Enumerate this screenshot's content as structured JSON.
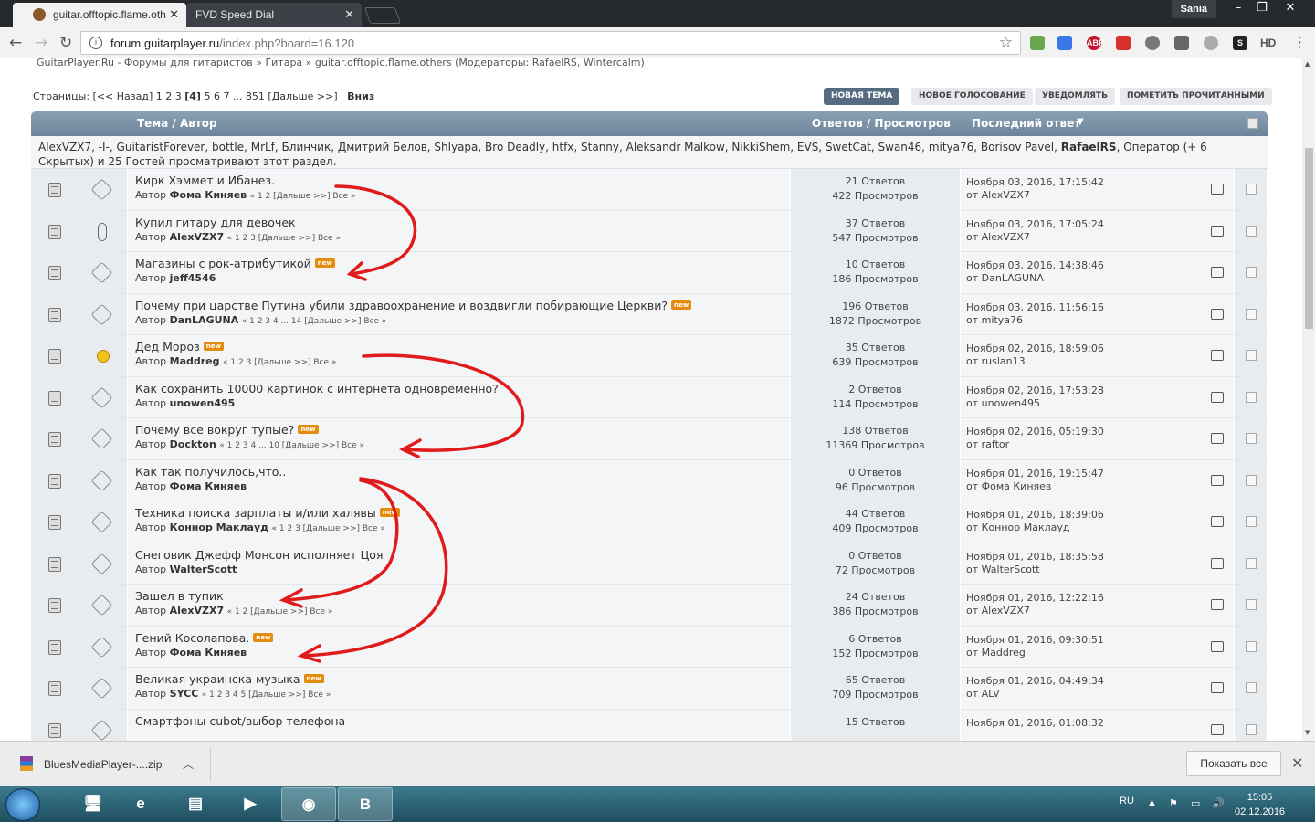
{
  "browser": {
    "tabs": [
      {
        "label": "guitar.offtopic.flame.oth"
      },
      {
        "label": "FVD Speed Dial"
      }
    ],
    "user": "Sania",
    "url_host": "forum.guitarplayer.ru",
    "url_path": "/index.php?board=16.120",
    "extensions": [
      "ABP",
      "S",
      "HD"
    ]
  },
  "forum": {
    "breadcrumb": "GuitarPlayer.Ru - Форумы для гитаристов » Гитара » guitar.offtopic.flame.others (Модераторы: RafaelRS, Wintercalm)",
    "pages_prefix": "Страницы: [<< Назад] 1 2 3",
    "pages_current": "[4]",
    "pages_suffix": "5 6 7 ... 851 [Дальше >>]",
    "pages_down": "Вниз",
    "buttons": {
      "new_topic": "НОВАЯ ТЕМА",
      "new_poll": "НОВОЕ ГОЛОСОВАНИЕ",
      "notify": "УВЕДОМЛЯТЬ",
      "mark_read": "ПОМЕТИТЬ ПРОЧИТАННЫМИ"
    },
    "header": {
      "topic": "Тема / Автор",
      "replies": "Ответов / Просмотров",
      "last": "Последний ответ"
    },
    "viewers_main": "AlexVZX7, -I-, GuitaristForever, bottle, MrLf, Блинчик, Дмитрий Белов, Shlyapa, Bro Deadly, htfx, Stanny, Aleksandr Malkow, NikkiShem, EVS, SwetCat, Swan46, mitya76, Borisov Pavel,",
    "viewers_bold": "RafaelRS",
    "viewers_tail": ", Оператор (+ 6 Скрытых) и 25 Гостей просматривают этот раздел.",
    "new_label": "new",
    "topics": [
      {
        "subject": "Кирк Хэммет и Ибанез.",
        "author_prefix": "Автор",
        "author": "Фома Киняев",
        "pages": "« 1 2 [Дальше >>]  Все »",
        "replies": "21 Ответов",
        "views": "422 Просмотров",
        "last_date": "Ноября 03, 2016, 17:15:42",
        "last_by": "от AlexVZX7",
        "is_new": false,
        "icon": "diamond"
      },
      {
        "subject": "Купил гитару для девочек",
        "author_prefix": "Автор",
        "author": "AlexVZX7",
        "pages": "« 1 2 3 [Дальше >>]  Все »",
        "replies": "37 Ответов",
        "views": "547 Просмотров",
        "last_date": "Ноября 03, 2016, 17:05:24",
        "last_by": "от AlexVZX7",
        "is_new": false,
        "icon": "clip"
      },
      {
        "subject": "Магазины с рок-атрибутикой",
        "author_prefix": "Автор",
        "author": "jeff4546",
        "pages": "",
        "replies": "10 Ответов",
        "views": "186 Просмотров",
        "last_date": "Ноября 03, 2016, 14:38:46",
        "last_by": "от DanLAGUNA",
        "is_new": true,
        "icon": "diamond"
      },
      {
        "subject": "Почему при царстве Путина убили здравоохранение и воздвигли побирающие Церкви?",
        "author_prefix": "Автор",
        "author": "DanLAGUNA",
        "pages": "« 1 2 3 4 ... 14 [Дальше >>]  Все »",
        "replies": "196 Ответов",
        "views": "1872 Просмотров",
        "last_date": "Ноября 03, 2016, 11:56:16",
        "last_by": "от mitya76",
        "is_new": true,
        "icon": "diamond"
      },
      {
        "subject": "Дед Мороз",
        "author_prefix": "Автор",
        "author": "Maddreg",
        "pages": "« 1 2 3 [Дальше >>]  Все »",
        "replies": "35 Ответов",
        "views": "639 Просмотров",
        "last_date": "Ноября 02, 2016, 18:59:06",
        "last_by": "от ruslan13",
        "is_new": true,
        "icon": "smile"
      },
      {
        "subject": "Как сохранить 10000 картинок с интернета одновременно?",
        "author_prefix": "Автор",
        "author": "unowen495",
        "pages": "",
        "replies": "2 Ответов",
        "views": "114 Просмотров",
        "last_date": "Ноября 02, 2016, 17:53:28",
        "last_by": "от unowen495",
        "is_new": false,
        "icon": "diamond"
      },
      {
        "subject": "Почему все вокруг тупые?",
        "author_prefix": "Автор",
        "author": "Dockton",
        "pages": "« 1 2 3 4 ... 10 [Дальше >>]  Все »",
        "replies": "138 Ответов",
        "views": "11369 Просмотров",
        "last_date": "Ноября 02, 2016, 05:19:30",
        "last_by": "от raftor",
        "is_new": true,
        "icon": "diamond"
      },
      {
        "subject": "Как так получилось,что..",
        "author_prefix": "Автор",
        "author": "Фома Киняев",
        "pages": "",
        "replies": "0 Ответов",
        "views": "96 Просмотров",
        "last_date": "Ноября 01, 2016, 19:15:47",
        "last_by": "от Фома Киняев",
        "is_new": false,
        "icon": "diamond"
      },
      {
        "subject": "Техника поиска зарплаты и/или халявы",
        "author_prefix": "Автор",
        "author": "Коннор Маклауд",
        "pages": "« 1 2 3 [Дальше >>]  Все »",
        "replies": "44 Ответов",
        "views": "409 Просмотров",
        "last_date": "Ноября 01, 2016, 18:39:06",
        "last_by": "от Коннор Маклауд",
        "is_new": true,
        "icon": "diamond"
      },
      {
        "subject": "Снеговик Джефф Монсон исполняет Цоя",
        "author_prefix": "Автор",
        "author": "WalterScott",
        "pages": "",
        "replies": "0 Ответов",
        "views": "72 Просмотров",
        "last_date": "Ноября 01, 2016, 18:35:58",
        "last_by": "от WalterScott",
        "is_new": false,
        "icon": "diamond"
      },
      {
        "subject": "Зашел в тупик",
        "author_prefix": "Автор",
        "author": "AlexVZX7",
        "pages": "« 1 2 [Дальше >>]  Все »",
        "replies": "24 Ответов",
        "views": "386 Просмотров",
        "last_date": "Ноября 01, 2016, 12:22:16",
        "last_by": "от AlexVZX7",
        "is_new": false,
        "icon": "diamond"
      },
      {
        "subject": "Гений Косолапова.",
        "author_prefix": "Автор",
        "author": "Фома Киняев",
        "pages": "",
        "replies": "6 Ответов",
        "views": "152 Просмотров",
        "last_date": "Ноября 01, 2016, 09:30:51",
        "last_by": "от Maddreg",
        "is_new": true,
        "icon": "diamond"
      },
      {
        "subject": "Великая украинска музыка",
        "author_prefix": "Автор",
        "author": "SYCC",
        "pages": "« 1 2 3 4 5 [Дальше >>]  Все »",
        "replies": "65 Ответов",
        "views": "709 Просмотров",
        "last_date": "Ноября 01, 2016, 04:49:34",
        "last_by": "от ALV",
        "is_new": true,
        "icon": "diamond"
      },
      {
        "subject": "Смартфоны cubot/выбор телефона",
        "author_prefix": "",
        "author": "",
        "pages": "",
        "replies": "15 Ответов",
        "views": "",
        "last_date": "Ноября 01, 2016, 01:08:32",
        "last_by": "",
        "is_new": false,
        "icon": "diamond"
      }
    ]
  },
  "download_bar": {
    "file": "BluesMediaPlayer-....zip",
    "show_all": "Показать все"
  },
  "taskbar": {
    "lang": "RU",
    "time": "15:05",
    "date": "02.12.2016"
  },
  "colors": {
    "annotation_arrows": "#e01b1b",
    "header_blue": "#6c849a",
    "new_badge": "#e58b0e"
  }
}
